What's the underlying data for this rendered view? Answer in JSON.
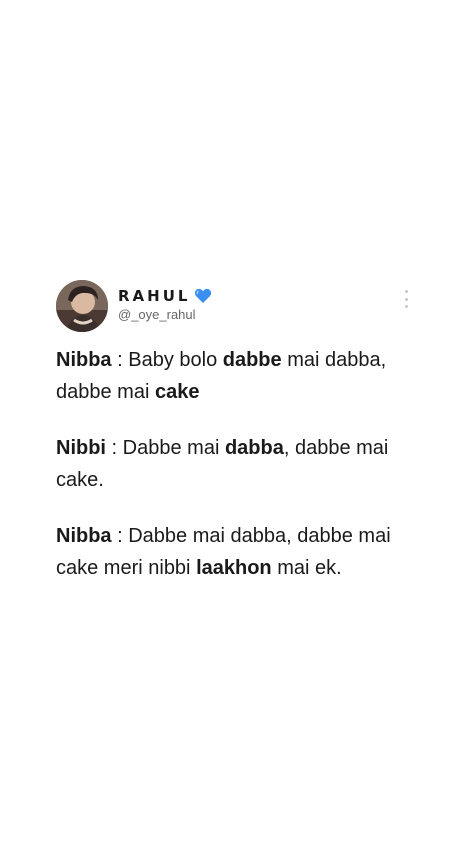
{
  "post": {
    "author": {
      "display_name": "RAHUL",
      "handle": "@_oye_rahul",
      "verified_icon": "blue-heart-icon",
      "avatar_icon": "profile-photo"
    },
    "more_icon": "vertical-ellipsis-icon",
    "accent_color": "#3b8ff0",
    "paragraphs": [
      {
        "speaker": "Nibba",
        "sep": " : ",
        "t1": "Baby bolo ",
        "b1": "dabbe",
        "t2": " mai dabba, dabbe mai ",
        "b2": "cake",
        "t3": ""
      },
      {
        "speaker": "Nibbi",
        "sep": " : ",
        "t1": "Dabbe mai ",
        "b1": "dabba",
        "t2": ", dabbe mai cake.",
        "b2": "",
        "t3": ""
      },
      {
        "speaker": "Nibba",
        "sep": " : ",
        "t1": "Dabbe mai dabba, dabbe mai cake meri nibbi ",
        "b1": "laakhon",
        "t2": " mai ek.",
        "b2": "",
        "t3": ""
      }
    ]
  }
}
